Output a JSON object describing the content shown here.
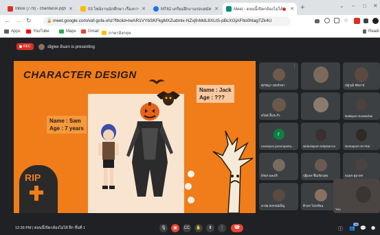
{
  "browser": {
    "tabs": [
      {
        "title": "Inbox (779) - chantarux.p@mahidol.ac.th",
        "favicon_color": "#d93025"
      },
      {
        "title": "03 ไฟล์งานนักศึกษา เรื่องการออกแบบตัวละคร",
        "favicon_color": "#fbbc04"
      },
      {
        "title": "MT62 เตรียมฝึกงานรอบสมัครใจ",
        "favicon_color": "#1a73e8"
      },
      {
        "title": "Meet - ตอนนี้เปิดกล้องไม่ได้",
        "favicon_color": "#00897b"
      }
    ],
    "url": "meet.google.com/vaf-gsfa-xhz?fbclid=IwAR1VYbSKFkgMXZudmlx-NZxjfnMdL8XLtS-pBcXGjAFIto0htagTZk4U",
    "new_tab": "+",
    "window_controls": {
      "minimize": "–",
      "maximize": "□",
      "close": "✕"
    }
  },
  "bookmarks": [
    {
      "label": "Apps",
      "icon": "apps-grid-icon",
      "color": "#5f6368"
    },
    {
      "label": "YouTube",
      "icon": "youtube-icon",
      "color": "#ff0000"
    },
    {
      "label": "Maps",
      "icon": "maps-icon",
      "color": "#34a853"
    },
    {
      "label": "Gmail",
      "icon": "gmail-icon",
      "color": "#ea4335"
    },
    {
      "label": "ภาษาอังกฤษ",
      "icon": "folder-icon",
      "color": "#fbbc04"
    }
  ],
  "reading_list": "Readi",
  "meet": {
    "rec_label": "REC",
    "presenter_text": "ณัฐพล อ้นอก is presenting",
    "slide": {
      "title": "CHARACTER DESIGN",
      "sam_name": "Name : Sam",
      "sam_age": "Age : 7 years",
      "jack_name": "Name : Jack",
      "jack_age": "Age : ???",
      "rip_label": "RIP"
    },
    "participants": [
      {
        "name": "ศุภัชญา เทพรักษา",
        "type": "video",
        "color": "#6d5a4a"
      },
      {
        "name": "",
        "type": "video",
        "color": "#7b6a5c"
      },
      {
        "name": "ณัฐวุฒิ ชัยยาช",
        "type": "video",
        "color": "#5a4a40"
      },
      {
        "name": "สไตล์ ลิ้นระรั่ว",
        "type": "video",
        "color": "#6a584a"
      },
      {
        "name": "",
        "type": "video",
        "color": "#8a7b6e"
      },
      {
        "name": "Natlapon Suwatchai",
        "type": "video",
        "color": "#4d4040"
      },
      {
        "name": "rouenpon jareonpanta...",
        "type": "letter",
        "letter": "r",
        "color": "#0b8043"
      },
      {
        "name": "wideclapom tekpisarrou",
        "type": "video",
        "color": "#3a3030"
      },
      {
        "name": "Dentaporn Sri-Rar",
        "type": "video",
        "color": "#2e2a28"
      },
      {
        "name": "ธีรพร ผลเจริ",
        "type": "video",
        "color": "#7a6a60"
      },
      {
        "name": "ปฐิมพร ชิ้นเรียวสุข",
        "type": "video",
        "color": "#6a5a50"
      },
      {
        "name": "ธนพร สุมาทร",
        "type": "video",
        "color": "#4a4240"
      },
      {
        "name": "อาจัย สังกรณ์เพ็ญ",
        "type": "video",
        "color": "#5a4a40"
      },
      {
        "name": "ศิวพร โปรเรียน",
        "type": "video",
        "color": "#8a7060"
      },
      {
        "name": "You",
        "type": "video",
        "color": "#3a3432"
      }
    ],
    "bottom": {
      "time": "12:36 PM",
      "meeting_name": "ตอนนี้เปิดกล้องไม่ได้ ฝึก ขั้นที่ 1",
      "participant_count": "16"
    }
  }
}
